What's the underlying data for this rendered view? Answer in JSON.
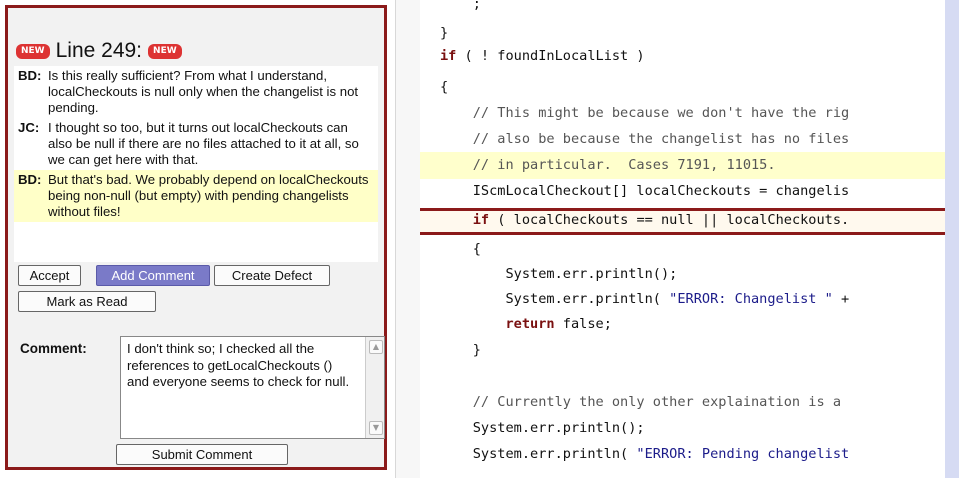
{
  "review": {
    "line_title": "Line 249:",
    "new_badge": "NEW",
    "thread": [
      {
        "author": "BD:",
        "text": "Is this really sufficient? From what I understand, localCheckouts is null only when the changelist is not pending.",
        "highlight": false
      },
      {
        "author": "JC:",
        "text": "I thought so too, but it turns out localCheckouts can also be null if there are no files attached to it at all, so we can get here with that.",
        "highlight": false
      },
      {
        "author": "BD:",
        "text": "But that's bad. We probably depend on localCheckouts being non-null (but empty) with pending changelists without files!",
        "highlight": true
      }
    ],
    "buttons": {
      "accept": "Accept",
      "add_comment": "Add Comment",
      "create_defect": "Create Defect",
      "mark_as_read": "Mark as Read",
      "submit_comment": "Submit Comment"
    },
    "comment_label": "Comment:",
    "comment_value": "I don't think so; I checked all the references to getLocalCheckouts () and everyone seems to check for null."
  },
  "code": {
    "lines": [
      {
        "text": "    ;",
        "style": "normal"
      },
      {
        "text": "}",
        "style": "normal"
      },
      {
        "text": "if ( ! foundInLocalList )",
        "style": "if"
      },
      {
        "text": "{",
        "style": "normal"
      },
      {
        "text": "    // This might be because we don't have the rig",
        "style": "comment"
      },
      {
        "text": "    // also be because the changelist has no files",
        "style": "comment"
      },
      {
        "text": "    // in particular.  Cases 7191, 11015.",
        "style": "comment"
      },
      {
        "text": "    IScmLocalCheckout[] localCheckouts = changelis",
        "style": "normal"
      },
      {
        "text": "    if ( localCheckouts == null || localCheckouts.",
        "style": "if"
      },
      {
        "text": "    {",
        "style": "normal"
      },
      {
        "text": "        System.err.println();",
        "style": "normal"
      },
      {
        "text": "        System.err.println( \"ERROR: Changelist \" +",
        "style": "string"
      },
      {
        "text": "        return false;",
        "style": "return"
      },
      {
        "text": "    }",
        "style": "normal"
      },
      {
        "text": "",
        "style": "normal"
      },
      {
        "text": "    // Currently the only other explaination is a",
        "style": "comment"
      },
      {
        "text": "    System.err.println();",
        "style": "normal"
      },
      {
        "text": "    System.err.println( \"ERROR: Pending changelist",
        "style": "string"
      }
    ]
  },
  "colors": {
    "accent_red": "#8b1a1a",
    "highlight_yellow": "#ffffc8",
    "primary_button": "#7a7ac8"
  }
}
